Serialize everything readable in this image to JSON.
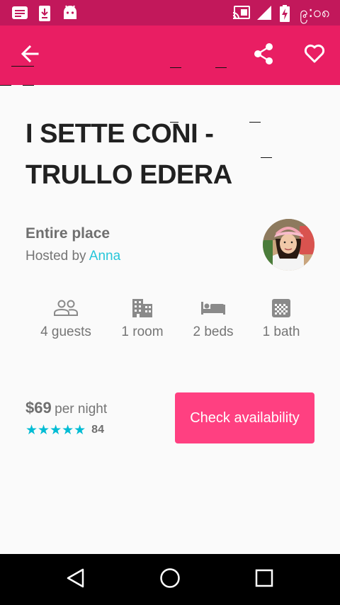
{
  "status_bar": {
    "time": "၉:၀၈",
    "icons": [
      "notification-icon",
      "download-icon",
      "android-icon",
      "cast-icon",
      "signal-icon",
      "battery-charging-icon"
    ]
  },
  "app_bar": {
    "back_icon": "arrow-back-icon",
    "share_icon": "share-icon",
    "favorite_icon": "heart-outline-icon",
    "color": "#e91e63"
  },
  "listing": {
    "title_line1": "I SETTE CONI -",
    "title_line2": "TRULLO EDERA",
    "place_type": "Entire place",
    "hosted_by_prefix": "Hosted by ",
    "host_name": "Anna"
  },
  "amenities": [
    {
      "icon": "guests-icon",
      "label": "4 guests"
    },
    {
      "icon": "room-icon",
      "label": "1 room"
    },
    {
      "icon": "bed-icon",
      "label": "2 beds"
    },
    {
      "icon": "bath-icon",
      "label": "1 bath"
    }
  ],
  "booking": {
    "price": "$69",
    "per_night": "per night",
    "stars": "★★★★★",
    "rating": 5,
    "review_count": "84",
    "button_label": "Check availability",
    "accent": "#ff4081",
    "star_color": "#00bcd4"
  },
  "nav_bar": {
    "icons": [
      "back-triangle-icon",
      "home-circle-icon",
      "recents-square-icon"
    ]
  }
}
